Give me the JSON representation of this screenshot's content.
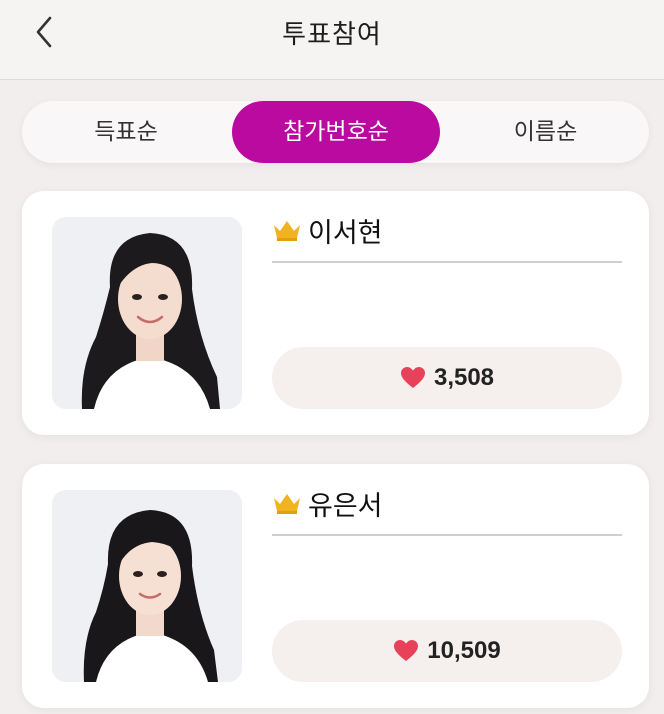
{
  "header": {
    "title": "투표참여",
    "back_icon": "chevron-left-icon"
  },
  "sort_tabs": {
    "items": [
      {
        "label": "득표순",
        "active": false
      },
      {
        "label": "참가번호순",
        "active": true
      },
      {
        "label": "이름순",
        "active": false
      }
    ],
    "active_color": "#bb0a9f"
  },
  "candidates": [
    {
      "name": "이서현",
      "votes": "3,508",
      "badge_icon": "crown-icon",
      "vote_icon": "heart-icon"
    },
    {
      "name": "유은서",
      "votes": "10,509",
      "badge_icon": "crown-icon",
      "vote_icon": "heart-icon"
    }
  ],
  "colors": {
    "crown": "#f2b320",
    "heart": "#e8425a",
    "vote_pill_bg": "#f5efed"
  }
}
